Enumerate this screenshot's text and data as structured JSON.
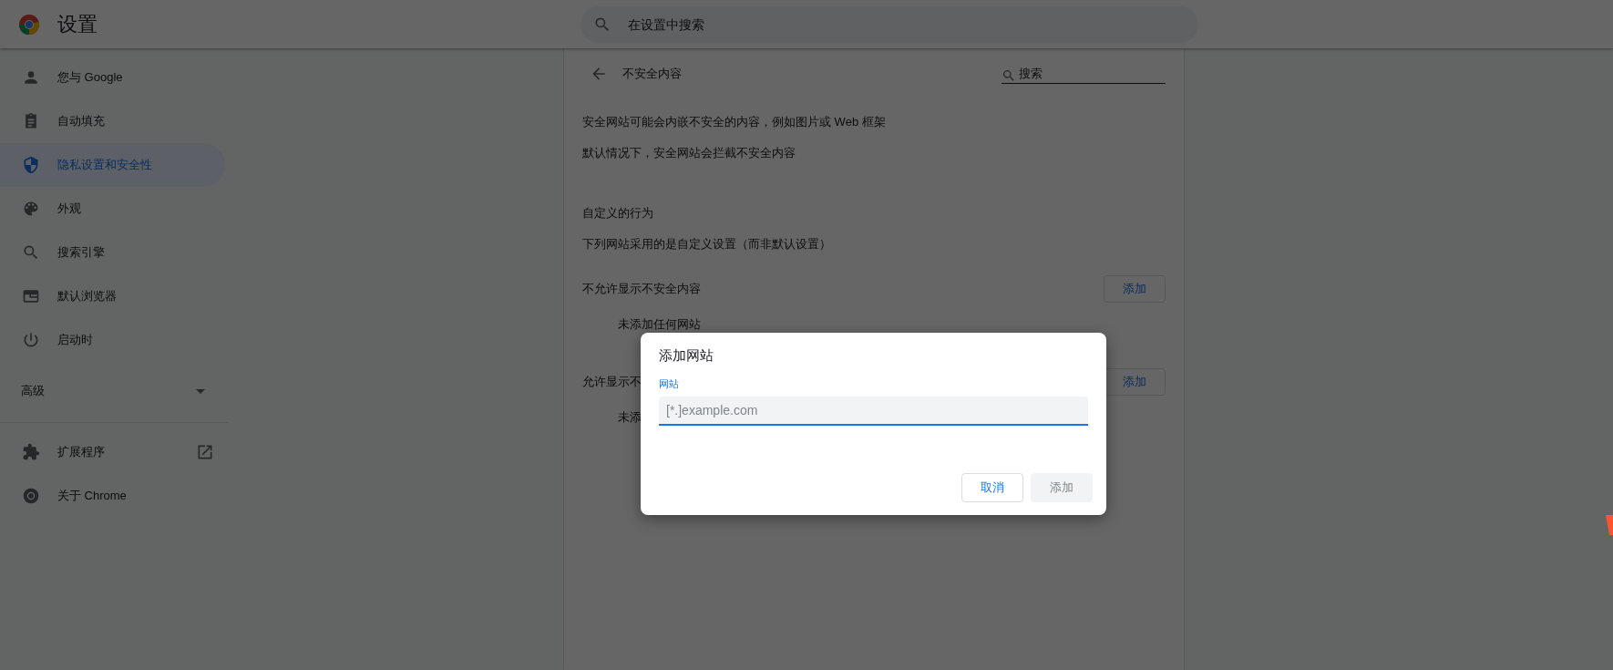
{
  "header": {
    "title": "设置",
    "search": {
      "placeholder": "在设置中搜索"
    }
  },
  "sidebar": {
    "items": [
      {
        "label": "您与 Google",
        "selected": false
      },
      {
        "label": "自动填充",
        "selected": false
      },
      {
        "label": "隐私设置和安全性",
        "selected": true
      },
      {
        "label": "外观",
        "selected": false
      },
      {
        "label": "搜索引擎",
        "selected": false
      },
      {
        "label": "默认浏览器",
        "selected": false
      },
      {
        "label": "启动时",
        "selected": false
      }
    ],
    "advanced": {
      "label": "高级",
      "expanded": false
    },
    "extra_items": [
      {
        "label": "扩展程序",
        "external": true
      },
      {
        "label": "关于 Chrome",
        "external": false
      }
    ]
  },
  "page": {
    "title": "不安全内容",
    "search": {
      "placeholder": "搜索"
    },
    "description": [
      "安全网站可能会内嵌不安全的内容，例如图片或 Web 框架",
      "默认情况下，安全网站会拦截不安全内容"
    ],
    "custom": {
      "heading": "自定义的行为",
      "subheading": "下列网站采用的是自定义设置（而非默认设置）"
    },
    "sections": [
      {
        "label": "不允许显示不安全内容",
        "button": "添加",
        "empty": "未添加任何网站"
      },
      {
        "label": "允许显示不",
        "button": "添加",
        "empty": "未添"
      }
    ]
  },
  "dialog": {
    "title": "添加网站",
    "field": {
      "label": "网站",
      "placeholder": "[*.]example.com"
    },
    "buttons": [
      {
        "label": "取消",
        "disabled": false
      },
      {
        "label": "添加",
        "disabled": true
      }
    ]
  }
}
